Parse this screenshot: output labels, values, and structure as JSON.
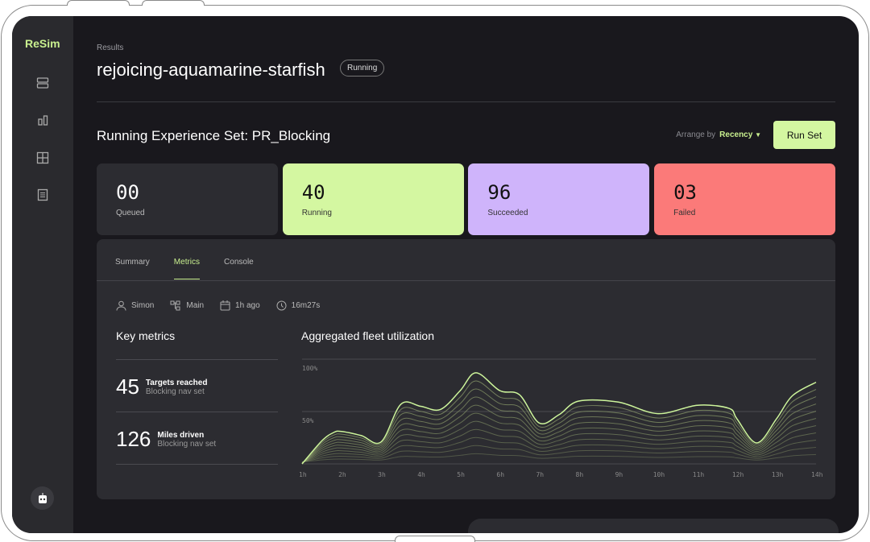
{
  "app": {
    "logo": "ReSim"
  },
  "sidebar": {
    "items": [
      {
        "icon": "rows-icon"
      },
      {
        "icon": "bar-chart-icon"
      },
      {
        "icon": "grid-icon"
      },
      {
        "icon": "document-icon"
      }
    ],
    "bottom_icon": "robot-icon"
  },
  "header": {
    "breadcrumb": "Results",
    "title": "rejoicing-aquamarine-starfish",
    "status": "Running"
  },
  "set": {
    "title": "Running Experience Set: PR_Blocking",
    "arrange_label": "Arrange by",
    "arrange_value": "Recency",
    "run_button": "Run Set"
  },
  "stats": [
    {
      "value": "00",
      "label": "Queued",
      "color": "#2c2c31"
    },
    {
      "value": "40",
      "label": "Running",
      "color": "#d4f7a1"
    },
    {
      "value": "96",
      "label": "Succeeded",
      "color": "#cfb4fb"
    },
    {
      "value": "03",
      "label": "Failed",
      "color": "#fb7a79"
    }
  ],
  "tabs": [
    "Summary",
    "Metrics",
    "Console"
  ],
  "active_tab": "Metrics",
  "meta": {
    "user": "Simon",
    "branch": "Main",
    "time": "1h ago",
    "duration": "16m27s"
  },
  "key_metrics": {
    "title": "Key metrics",
    "items": [
      {
        "value": "45",
        "label": "Targets reached",
        "sub": "Blocking nav set"
      },
      {
        "value": "126",
        "label": "Miles driven",
        "sub": "Blocking nav set"
      }
    ]
  },
  "chart_data": {
    "type": "line",
    "title": "Aggregated fleet utilization",
    "x_ticks": [
      "1h",
      "2h",
      "3h",
      "4h",
      "5h",
      "6h",
      "7h",
      "8h",
      "9h",
      "10h",
      "11h",
      "12h",
      "13h",
      "14h"
    ],
    "y_ticks": [
      "100%",
      "50%"
    ],
    "ylim": [
      0,
      100
    ],
    "x": [
      1,
      1.5,
      1.8,
      2,
      2.5,
      3,
      3.5,
      4,
      4.5,
      5,
      5.4,
      6,
      6.5,
      7,
      7.5,
      8,
      9,
      10,
      11,
      11.8,
      12,
      12.5,
      13,
      13.4,
      14
    ],
    "top_series": [
      0,
      22,
      30,
      31,
      27,
      21,
      57,
      55,
      52,
      70,
      87,
      70,
      66,
      39,
      47,
      60,
      59,
      48,
      56,
      53,
      43,
      20,
      43,
      65,
      78
    ],
    "layer_count": 11,
    "accent": "#cdf59b"
  }
}
